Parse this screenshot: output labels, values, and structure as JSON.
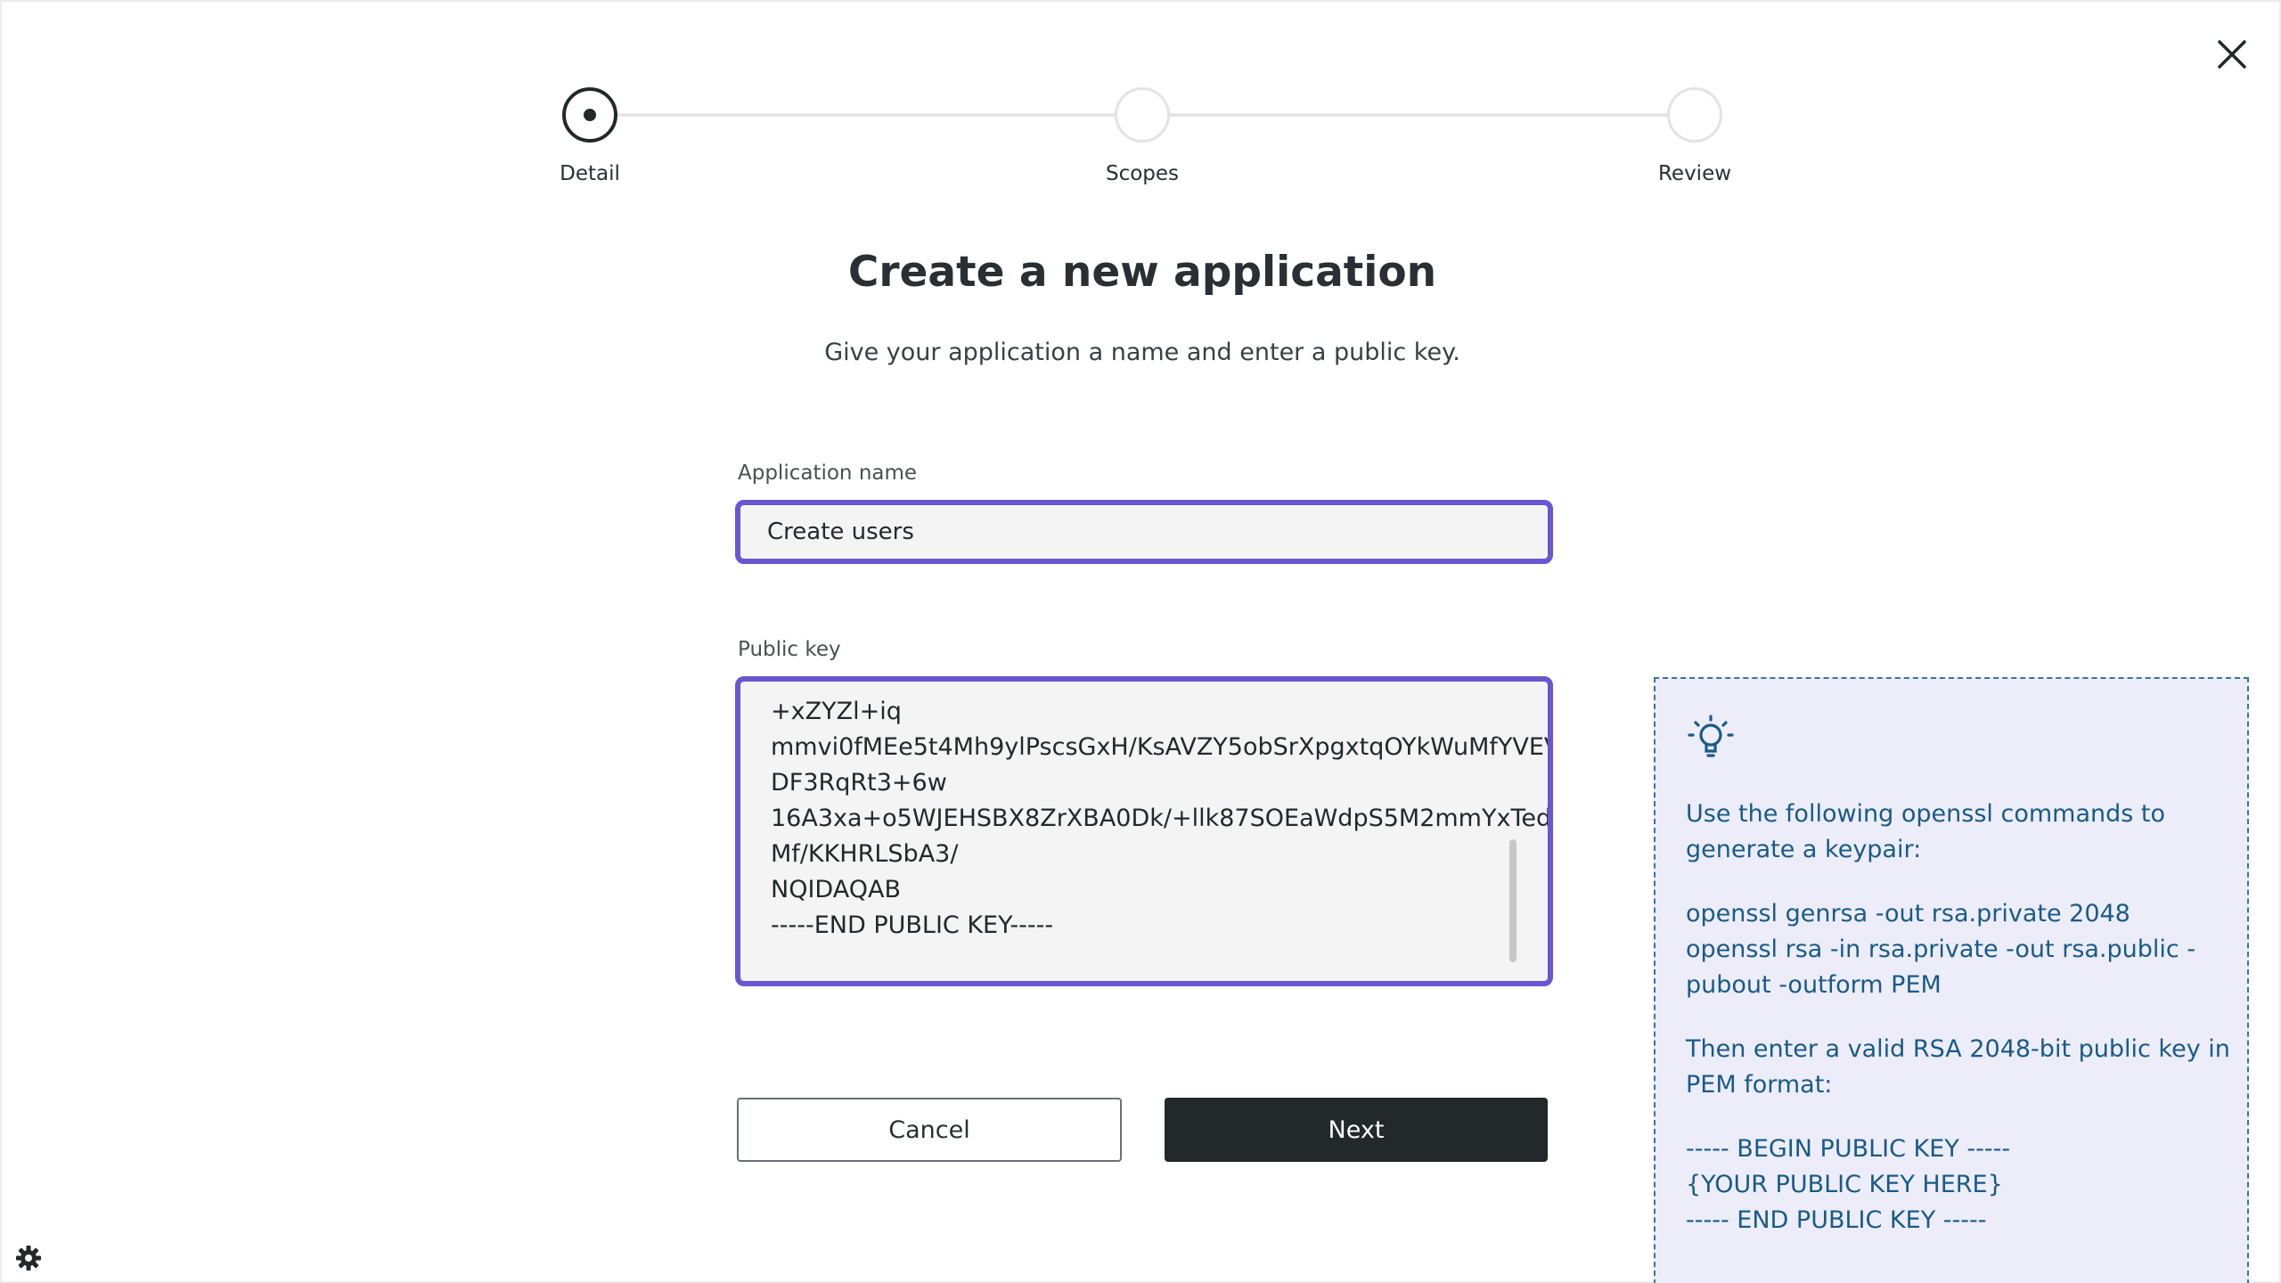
{
  "stepper": {
    "steps": [
      {
        "label": "Detail",
        "state": "active"
      },
      {
        "label": "Scopes",
        "state": "inactive"
      },
      {
        "label": "Review",
        "state": "inactive"
      }
    ]
  },
  "header": {
    "title": "Create a new application",
    "subtitle": "Give your application a name and enter a public key."
  },
  "form": {
    "app_name_label": "Application name",
    "app_name_value": "Create users",
    "public_key_label": "Public key",
    "public_key_value": "+xZYZl+iq\nmmvi0fMEe5t4Mh9ylPscsGxH/KsAVZY5obSrXpgxtqOYkWuMfYVEV\nDF3RqRt3+6w\n16A3xa+o5WJEHSBX8ZrXBA0Dk/+llk87SOEaWdpS5M2mmYxTedd\nMf/KKHRLSbA3/\nNQIDAQAB\n-----END PUBLIC KEY-----"
  },
  "actions": {
    "cancel_label": "Cancel",
    "next_label": "Next"
  },
  "tip": {
    "icon": "lightbulb-icon",
    "intro_1": "Use the following openssl commands to",
    "intro_2": "generate a keypair:",
    "cmd_1": "openssl genrsa -out rsa.private 2048",
    "cmd_2": "openssl rsa -in rsa.private -out rsa.public -",
    "cmd_3": "pubout -outform PEM",
    "then_1": "Then enter a valid RSA 2048-bit public key in",
    "then_2": "PEM format:",
    "pem_1": "----- BEGIN PUBLIC KEY -----",
    "pem_2": "{YOUR PUBLIC KEY HERE}",
    "pem_3": "----- END PUBLIC KEY -----"
  },
  "colors": {
    "accent": "#6a56d0",
    "dark": "#23282b",
    "tip_text": "#1a5a88",
    "tip_bg": "#ecedf9"
  }
}
